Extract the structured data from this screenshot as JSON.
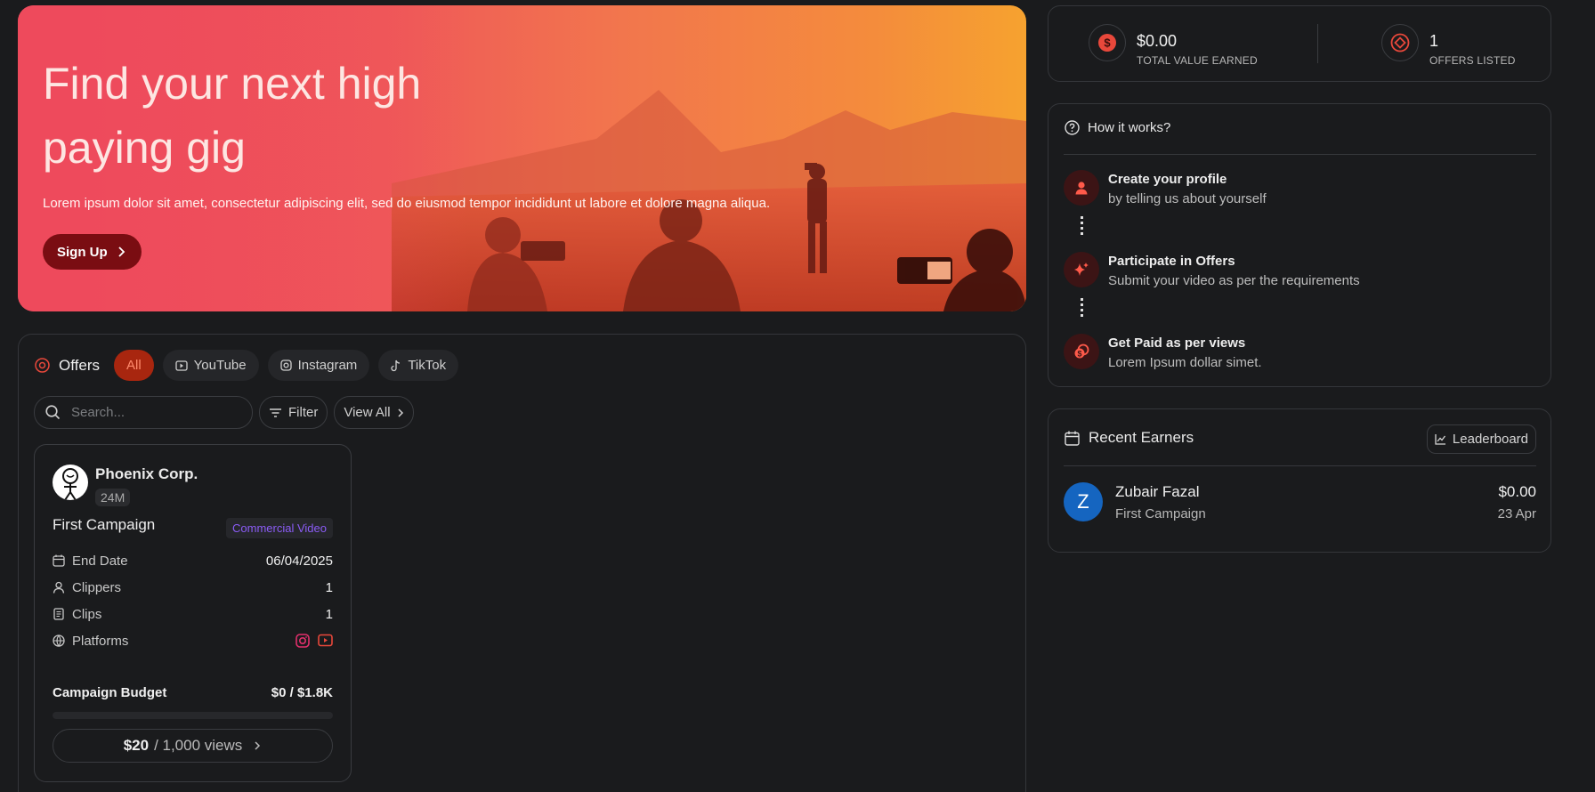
{
  "hero": {
    "title": "Find your next high paying gig",
    "description": "Lorem ipsum dolor sit amet, consectetur adipiscing elit, sed do eiusmod tempor incididunt ut labore et dolore magna aliqua.",
    "cta_label": "Sign Up"
  },
  "offers": {
    "title": "Offers",
    "filters": [
      {
        "label": "All",
        "icon": "none",
        "active": true
      },
      {
        "label": "YouTube",
        "icon": "youtube-icon",
        "active": false
      },
      {
        "label": "Instagram",
        "icon": "instagram-icon",
        "active": false
      },
      {
        "label": "TikTok",
        "icon": "tiktok-icon",
        "active": false
      }
    ],
    "search_placeholder": "Search...",
    "filter_label": "Filter",
    "view_all_label": "View All",
    "card": {
      "brand_name": "Phoenix Corp.",
      "brand_followers": "24M",
      "campaign_name": "First Campaign",
      "category": "Commercial Video",
      "rows": [
        {
          "label": "End Date",
          "value": "06/04/2025",
          "icon": "calendar-icon"
        },
        {
          "label": "Clippers",
          "value": "1",
          "icon": "user-icon"
        },
        {
          "label": "Clips",
          "value": "1",
          "icon": "document-icon"
        },
        {
          "label": "Platforms",
          "value": "",
          "icon": "globe-icon"
        }
      ],
      "budget_label": "Campaign Budget",
      "budget_value": "$0 / $1.8K",
      "budget_progress": 0,
      "rate_amount": "$20",
      "rate_unit": "/ 1,000 views"
    }
  },
  "stats": {
    "earned_value": "$0.00",
    "earned_label": "TOTAL VALUE EARNED",
    "offers_value": "1",
    "offers_label": "OFFERS LISTED"
  },
  "how_it_works": {
    "title": "How it works?",
    "steps": [
      {
        "title": "Create your profile",
        "desc": "by telling us about yourself",
        "icon": "user-icon"
      },
      {
        "title": "Participate in Offers",
        "desc": "Submit your video as per the requirements",
        "icon": "sparkle-icon"
      },
      {
        "title": "Get Paid as per views",
        "desc": "Lorem Ipsum dollar simet.",
        "icon": "coins-icon"
      }
    ]
  },
  "recent_earners": {
    "title": "Recent Earners",
    "leaderboard_label": "Leaderboard",
    "items": [
      {
        "initial": "Z",
        "name": "Zubair Fazal",
        "campaign": "First Campaign",
        "amount": "$0.00",
        "date": "23 Apr"
      }
    ]
  },
  "colors": {
    "accent": "#e9483b",
    "hero_start": "#ee4a5c",
    "hero_end": "#f6a22f",
    "avatar": "#1565c0"
  }
}
